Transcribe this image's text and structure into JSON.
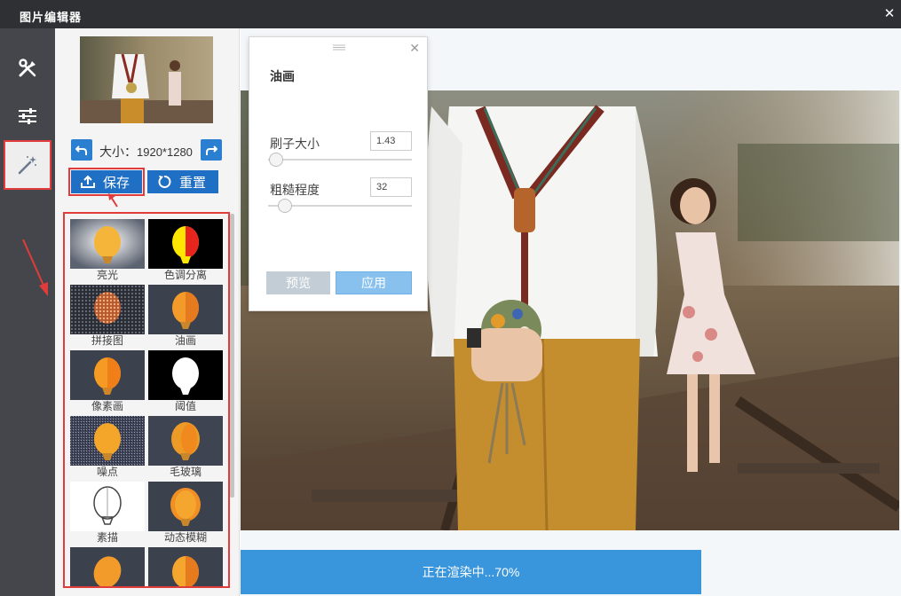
{
  "window": {
    "title": "图片编辑器"
  },
  "toolbar": {
    "tools_icon": "tools-icon",
    "adjust_icon": "sliders-icon",
    "effects_icon": "magic-wand-icon"
  },
  "image": {
    "size_label": "大小：",
    "size_value": "1920*1280"
  },
  "actions": {
    "save_label": "保存",
    "reset_label": "重置"
  },
  "filters": [
    {
      "label": "亮光"
    },
    {
      "label": "色调分离"
    },
    {
      "label": "拼接图"
    },
    {
      "label": "油画"
    },
    {
      "label": "像素画"
    },
    {
      "label": "阈值"
    },
    {
      "label": "噪点"
    },
    {
      "label": "毛玻璃"
    },
    {
      "label": "素描"
    },
    {
      "label": "动态模糊"
    },
    {
      "label": ""
    },
    {
      "label": ""
    }
  ],
  "dialog": {
    "title": "油画",
    "params": [
      {
        "label": "刷子大小",
        "value": "1.43"
      },
      {
        "label": "粗糙程度",
        "value": "32"
      }
    ],
    "preview_label": "预览",
    "apply_label": "应用"
  },
  "progress": {
    "text": "正在渲染中...70%",
    "percent": 70
  },
  "colors": {
    "accent": "#1f6fc4",
    "highlight": "#e23b3b",
    "progress": "#3a96dc"
  }
}
